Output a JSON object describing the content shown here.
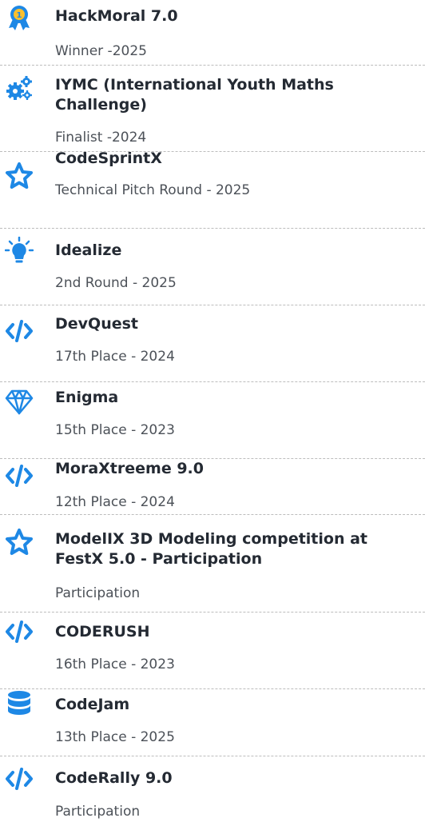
{
  "accent_color": "#1e88e5",
  "achievements": [
    {
      "icon": "award-medal-icon",
      "title": "HackMoral 7.0",
      "subtitle": "Winner -2025"
    },
    {
      "icon": "gears-icon",
      "title": "IYMC (International Youth Maths Challenge)",
      "subtitle": "Finalist -2024"
    },
    {
      "icon": "star-outline-icon",
      "title": "CodeSprintX",
      "subtitle": "Technical Pitch Round - 2025"
    },
    {
      "icon": "lightbulb-icon",
      "title": "Idealize",
      "subtitle": "2nd Round - 2025"
    },
    {
      "icon": "code-icon",
      "title": "DevQuest",
      "subtitle": "17th Place - 2024"
    },
    {
      "icon": "gem-icon",
      "title": "Enigma",
      "subtitle": "15th Place - 2023"
    },
    {
      "icon": "code-icon",
      "title": "MoraXtreeme 9.0",
      "subtitle": "12th Place - 2024"
    },
    {
      "icon": "star-outline-icon",
      "title": "ModelIX 3D Modeling competition at FestX 5.0 - Participation",
      "subtitle": "Participation"
    },
    {
      "icon": "code-icon",
      "title": "CODERUSH",
      "subtitle": "16th Place  - 2023"
    },
    {
      "icon": "database-icon",
      "title": "CodeJam",
      "subtitle": "13th Place - 2025"
    },
    {
      "icon": "code-icon",
      "title": "CodeRally 9.0",
      "subtitle": "Participation"
    }
  ]
}
